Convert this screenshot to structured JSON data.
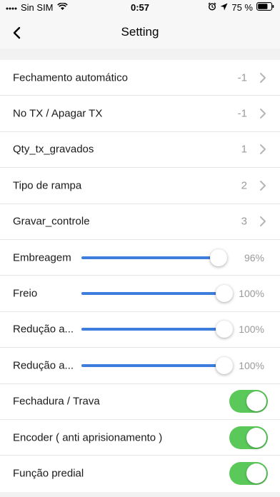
{
  "status_bar": {
    "carrier": "Sin SIM",
    "time": "0:57",
    "battery_percent": "75 %",
    "battery_level": 0.75,
    "icons": [
      "wifi-icon",
      "alarm-icon",
      "location-arrow-icon",
      "battery-icon"
    ]
  },
  "header": {
    "title": "Setting",
    "back_icon": "chevron-left-icon"
  },
  "settings": {
    "nav_rows": [
      {
        "label": "Fechamento automático",
        "value": "-1"
      },
      {
        "label": "No TX / Apagar TX",
        "value": "-1"
      },
      {
        "label": "Qty_tx_gravados",
        "value": "1"
      },
      {
        "label": "Tipo de rampa",
        "value": "2"
      },
      {
        "label": "Gravar_controle",
        "value": "3"
      }
    ],
    "slider_rows": [
      {
        "label": "Embreagem",
        "percent_text": "96%",
        "level": 0.96
      },
      {
        "label": "Freio",
        "percent_text": "100%",
        "level": 1.0
      },
      {
        "label": "Redução a...",
        "percent_text": "100%",
        "level": 1.0
      },
      {
        "label": "Redução a...",
        "percent_text": "100%",
        "level": 1.0
      }
    ],
    "toggle_rows": [
      {
        "label": "Fechadura / Trava",
        "on": true
      },
      {
        "label": "Encoder ( anti aprisionamento )",
        "on": true
      },
      {
        "label": "Função predial",
        "on": true
      }
    ]
  },
  "colors": {
    "slider_accent": "#3d7ddd",
    "toggle_on": "#5ac95a",
    "value_text": "#9a9a9a"
  }
}
